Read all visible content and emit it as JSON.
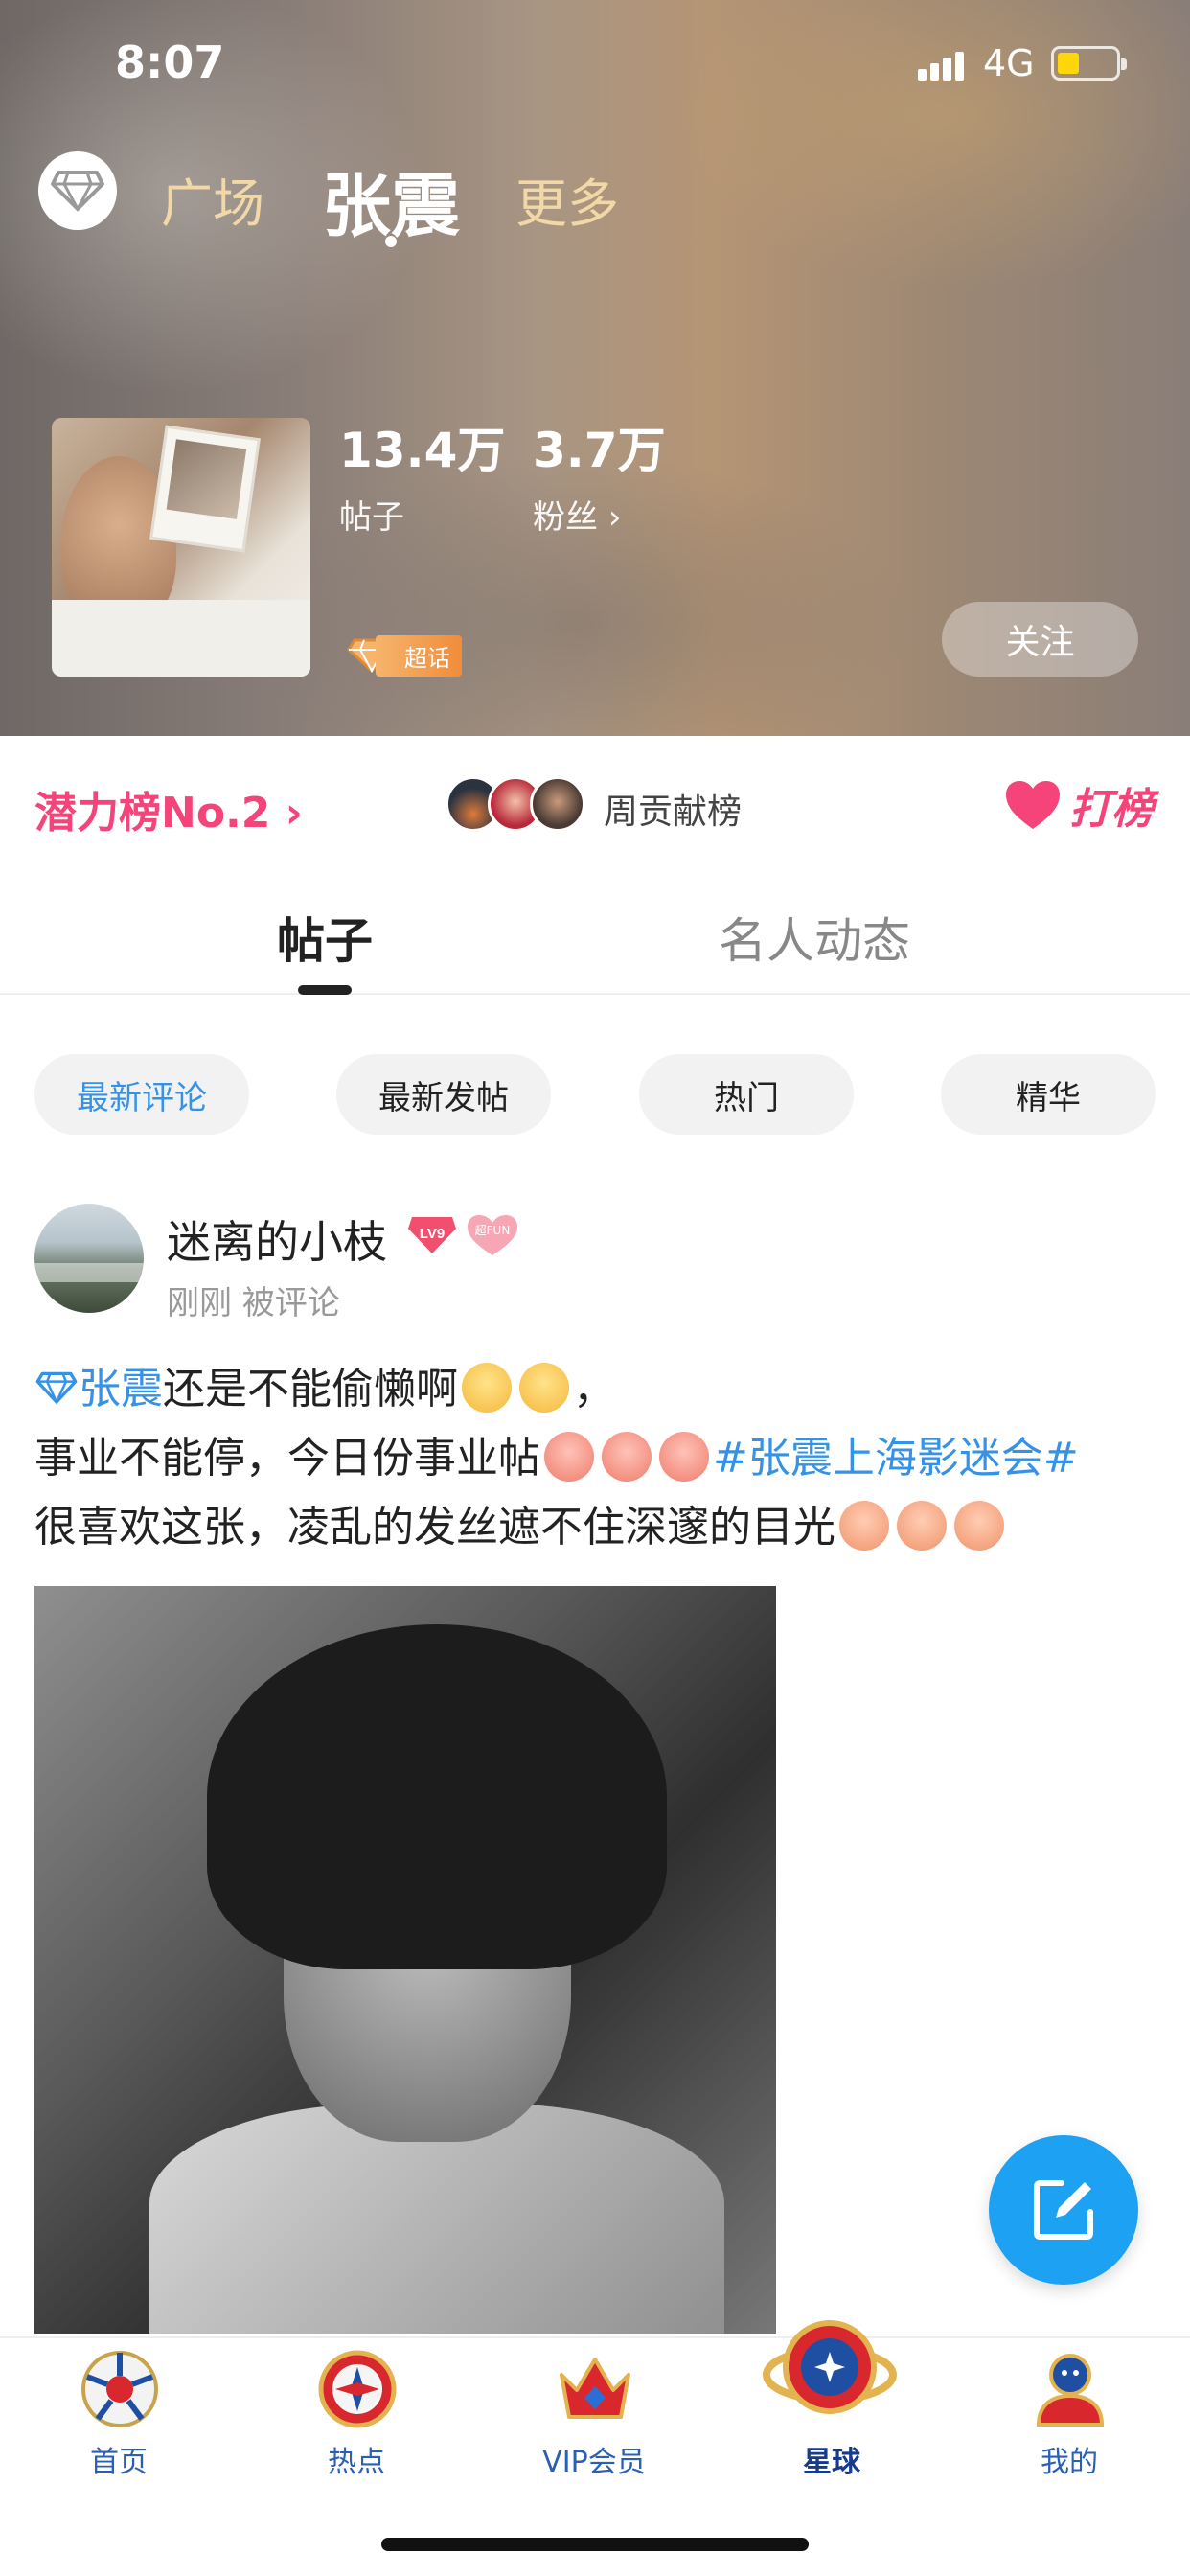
{
  "status_bar": {
    "time": "8:07",
    "network": "4G"
  },
  "top_nav": {
    "tabs": [
      "广场",
      "张震",
      "更多"
    ],
    "active_index": 1
  },
  "profile": {
    "posts_count": "13.4万",
    "posts_label": "帖子",
    "fans_count": "3.7万",
    "fans_label": "粉丝",
    "badge": "超话",
    "follow_label": "关注"
  },
  "rank": {
    "potential": "潜力榜No.2",
    "weekly": "周贡献榜",
    "dabang": "打榜"
  },
  "content_tabs": [
    "帖子",
    "名人动态"
  ],
  "filters": [
    "最新评论",
    "最新发帖",
    "热门",
    "精华"
  ],
  "post": {
    "username": "迷离的小枝",
    "level": "LV9",
    "fun_badge": "超FUN",
    "meta": "刚刚 被评论",
    "mention": "张震",
    "line1_text": "还是不能偷懒啊",
    "line1_end": "，",
    "line2_text": "事业不能停，今日份事业帖",
    "hashtag": "#张震上海影迷会#",
    "line3_text": "很喜欢这张，凌乱的发丝遮不住深邃的目光"
  },
  "bottom_nav": {
    "items": [
      "首页",
      "热点",
      "VIP会员",
      "星球",
      "我的"
    ],
    "active_index": 3
  },
  "colors": {
    "accent_pink": "#f4447a",
    "link_blue": "#3592e6",
    "fab_blue": "#1da1f2"
  }
}
